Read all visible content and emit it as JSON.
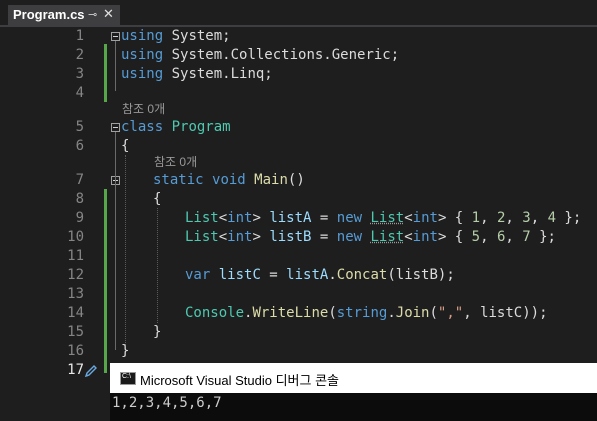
{
  "tab": {
    "filename": "Program.cs",
    "pin_glyph": "⊸",
    "close_glyph": "✕"
  },
  "line_numbers": [
    "1",
    "2",
    "3",
    "4",
    "5",
    "6",
    "7",
    "8",
    "9",
    "10",
    "11",
    "12",
    "13",
    "14",
    "15",
    "16",
    "17"
  ],
  "codelens": {
    "class_refs": "참조 0개",
    "method_refs": "참조 0개"
  },
  "code": {
    "l1": {
      "kw": "using",
      "ns": " System;"
    },
    "l2": {
      "kw": "using",
      "ns": " System.Collections.Generic;"
    },
    "l3": {
      "kw": "using",
      "ns": " System.Linq;"
    },
    "l5": {
      "kw": "class",
      "name": "Program"
    },
    "l6": {
      "brace": "{"
    },
    "l7": {
      "kw1": "static",
      "kw2": "void",
      "fn": "Main",
      "rest": "()"
    },
    "l8": {
      "brace": "{"
    },
    "l9": {
      "t1": "List",
      "p1": "<",
      "t2": "int",
      "p2": "> ",
      "v": "listA",
      "eq": " = ",
      "kw": "new",
      "sp": " ",
      "t3": "List",
      "p3": "<",
      "t4": "int",
      "p4": "> { ",
      "n1": "1",
      "c1": ", ",
      "n2": "2",
      "c2": ", ",
      "n3": "3",
      "c3": ", ",
      "n4": "4",
      "end": " };"
    },
    "l10": {
      "t1": "List",
      "p1": "<",
      "t2": "int",
      "p2": "> ",
      "v": "listB",
      "eq": " = ",
      "kw": "new",
      "sp": " ",
      "t3": "List",
      "p3": "<",
      "t4": "int",
      "p4": "> { ",
      "n1": "5",
      "c1": ", ",
      "n2": "6",
      "c2": ", ",
      "n3": "7",
      "end": " };"
    },
    "l12": {
      "kw": "var",
      "v": " listC",
      "eq": " = ",
      "a": "listA",
      "dot": ".",
      "fn": "Concat",
      "args": "(listB);"
    },
    "l14": {
      "ty": "Console",
      "dot": ".",
      "fn": "WriteLine",
      "p": "(",
      "kw": "string",
      "dot2": ".",
      "fn2": "Join",
      "p2": "(",
      "s": "\",\"",
      "rest": ", listC));"
    },
    "l15": {
      "brace": "}"
    },
    "l16": {
      "brace": "}"
    }
  },
  "console": {
    "icon_text": "C:\\",
    "title": "Microsoft Visual Studio 디버그 콘솔",
    "output": "1,2,3,4,5,6,7"
  },
  "colors": {
    "keyword": "#569cd6",
    "type": "#4ec9b0",
    "method": "#dcdcaa",
    "number": "#b5cea8",
    "string": "#d69d85",
    "change_bar": "#57a64a"
  }
}
